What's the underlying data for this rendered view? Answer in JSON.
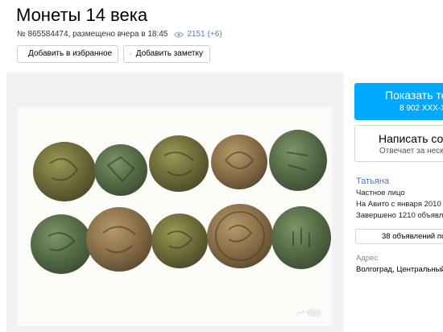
{
  "listing": {
    "title": "Монеты 14 века",
    "meta_text": "№ 865584474, размещено вчера в 18:45",
    "views": "2151",
    "views_delta": "(+6)"
  },
  "actions": {
    "favorite_label": "Добавить в избранное",
    "note_label": "Добавить заметку"
  },
  "gallery": {
    "watermark": "Avito"
  },
  "contact": {
    "phone_label": "Показать те",
    "phone_number": "8 902 XXX-X",
    "message_label": "Написать соо",
    "message_hint": "Отвечает за неско"
  },
  "seller": {
    "name": "Татьяна",
    "type": "Частное лицо",
    "since": "На Авито с января 2010",
    "completed": "Завершено 1210 объявле",
    "listings_label": "38 объявлений по"
  },
  "address": {
    "label": "Адрес",
    "value": "Волгоград, Центральный"
  },
  "colors": {
    "accent_blue": "#00aaff",
    "link_blue": "#4a78c0"
  }
}
